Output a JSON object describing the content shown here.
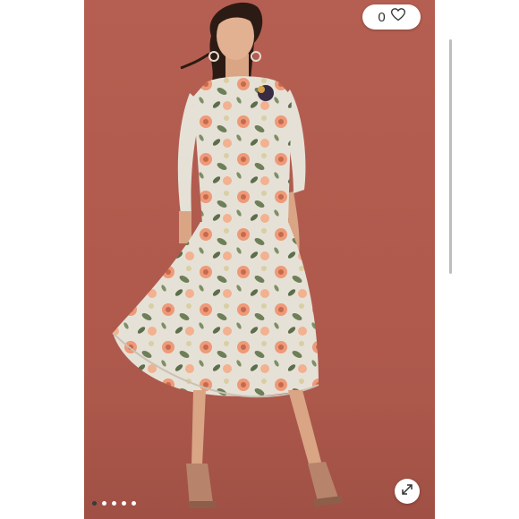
{
  "listing": {
    "like_count": "0",
    "like_icon": "heart-outline-icon",
    "expand_icon": "expand-diagonal-icon"
  },
  "carousel": {
    "total_images": 5,
    "active_index": 0
  },
  "colors": {
    "photo_backdrop": "#b05a4d",
    "indicator_active": "#3a3a3a",
    "indicator_inactive": "#ffffff"
  }
}
